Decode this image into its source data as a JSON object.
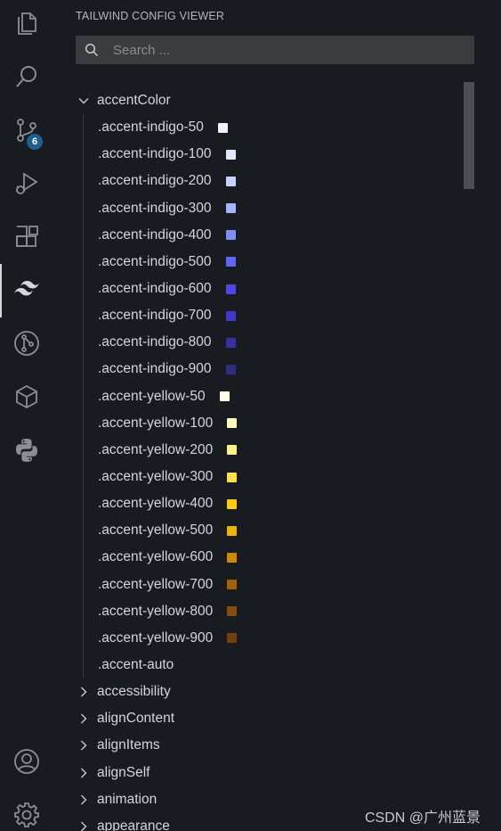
{
  "activity_bar": {
    "icons": [
      "explorer-icon",
      "search-icon",
      "source-control-icon",
      "run-debug-icon",
      "extensions-icon",
      "tailwind-icon",
      "git-graph-icon",
      "package-icon",
      "python-icon",
      "account-icon",
      "settings-gear-icon"
    ],
    "source_control_badge": "6",
    "badge_color": "#1f5e8f"
  },
  "panel": {
    "title": "TAILWIND CONFIG VIEWER",
    "search": {
      "placeholder": "Search ...",
      "value": ""
    }
  },
  "tree": {
    "expanded_group": {
      "label": "accentColor",
      "items": [
        {
          "label": ".accent-indigo-50",
          "color": "#eef2ff"
        },
        {
          "label": ".accent-indigo-100",
          "color": "#e0e7ff"
        },
        {
          "label": ".accent-indigo-200",
          "color": "#c7d2fe"
        },
        {
          "label": ".accent-indigo-300",
          "color": "#a5b4fc"
        },
        {
          "label": ".accent-indigo-400",
          "color": "#818cf8"
        },
        {
          "label": ".accent-indigo-500",
          "color": "#6366f1"
        },
        {
          "label": ".accent-indigo-600",
          "color": "#4f46e5"
        },
        {
          "label": ".accent-indigo-700",
          "color": "#4338ca"
        },
        {
          "label": ".accent-indigo-800",
          "color": "#3730a3"
        },
        {
          "label": ".accent-indigo-900",
          "color": "#312e81"
        },
        {
          "label": ".accent-yellow-50",
          "color": "#fefce8"
        },
        {
          "label": ".accent-yellow-100",
          "color": "#fef9c3"
        },
        {
          "label": ".accent-yellow-200",
          "color": "#fef08a"
        },
        {
          "label": ".accent-yellow-300",
          "color": "#fde047"
        },
        {
          "label": ".accent-yellow-400",
          "color": "#facc15"
        },
        {
          "label": ".accent-yellow-500",
          "color": "#eab308"
        },
        {
          "label": ".accent-yellow-600",
          "color": "#ca8a04"
        },
        {
          "label": ".accent-yellow-700",
          "color": "#a16207"
        },
        {
          "label": ".accent-yellow-800",
          "color": "#854d0e"
        },
        {
          "label": ".accent-yellow-900",
          "color": "#713f12"
        },
        {
          "label": ".accent-auto",
          "color": null
        }
      ]
    },
    "collapsed_groups": [
      "accessibility",
      "alignContent",
      "alignItems",
      "alignSelf",
      "animation",
      "appearance"
    ]
  },
  "watermark": "CSDN @广州蓝景"
}
